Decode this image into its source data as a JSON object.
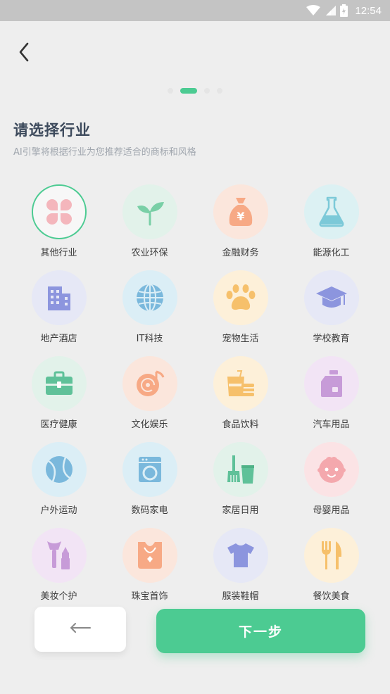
{
  "status_bar": {
    "time": "12:54",
    "icons": [
      "wifi-icon",
      "signal-icon",
      "battery-icon"
    ]
  },
  "header": {
    "back_icon": "chevron-left-icon"
  },
  "pager": {
    "pages": 4,
    "current": 2
  },
  "title": "请选择行业",
  "subtitle": "AI引擎将根据行业为您推荐适合的商标和风格",
  "industries": [
    {
      "label": "其他行业",
      "icon": "grid-icon",
      "selected": true
    },
    {
      "label": "农业环保",
      "icon": "sprout-icon",
      "selected": false
    },
    {
      "label": "金融财务",
      "icon": "money-bag-icon",
      "selected": false
    },
    {
      "label": "能源化工",
      "icon": "flask-icon",
      "selected": false
    },
    {
      "label": "地产酒店",
      "icon": "building-icon",
      "selected": false
    },
    {
      "label": "IT科技",
      "icon": "globe-icon",
      "selected": false
    },
    {
      "label": "宠物生活",
      "icon": "paw-icon",
      "selected": false
    },
    {
      "label": "学校教育",
      "icon": "graduation-cap-icon",
      "selected": false
    },
    {
      "label": "医疗健康",
      "icon": "medical-kit-icon",
      "selected": false
    },
    {
      "label": "文化娱乐",
      "icon": "music-disc-icon",
      "selected": false
    },
    {
      "label": "食品饮料",
      "icon": "food-drink-icon",
      "selected": false
    },
    {
      "label": "汽车用品",
      "icon": "fuel-can-icon",
      "selected": false
    },
    {
      "label": "户外运动",
      "icon": "tennis-ball-icon",
      "selected": false
    },
    {
      "label": "数码家电",
      "icon": "washing-machine-icon",
      "selected": false
    },
    {
      "label": "家居日用",
      "icon": "broom-bucket-icon",
      "selected": false
    },
    {
      "label": "母婴用品",
      "icon": "baby-face-icon",
      "selected": false
    },
    {
      "label": "美妆个护",
      "icon": "cosmetics-icon",
      "selected": false
    },
    {
      "label": "珠宝首饰",
      "icon": "necklace-icon",
      "selected": false
    },
    {
      "label": "服装鞋帽",
      "icon": "tshirt-icon",
      "selected": false
    },
    {
      "label": "餐饮美食",
      "icon": "fork-knife-icon",
      "selected": false
    }
  ],
  "footer": {
    "prev_icon": "arrow-left-icon",
    "next_label": "下一步"
  },
  "colors": {
    "accent": "#4ccb92",
    "background": "#eeeeee",
    "title": "#3d4a5c",
    "subtitle": "#a0a6ae"
  }
}
